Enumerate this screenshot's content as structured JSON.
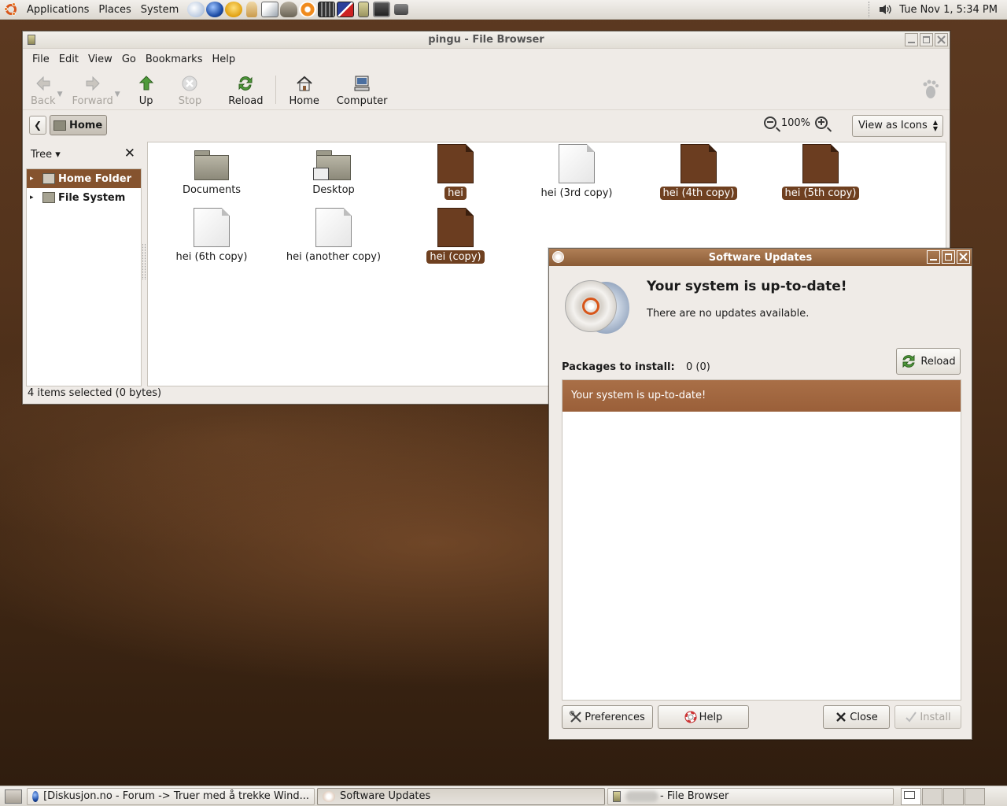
{
  "top_panel": {
    "menus": [
      "Applications",
      "Places",
      "System"
    ],
    "launcher_icons": [
      "web-browser-icon",
      "globe-icon",
      "messenger-icon",
      "pidgin-icon",
      "image-viewer-icon",
      "gimp-icon",
      "blender-icon",
      "calculator-icon",
      "text-editor-icon",
      "file-cabinet-icon",
      "terminal-icon",
      "camera-icon"
    ],
    "clock": "Tue Nov  1,  5:34 PM"
  },
  "file_browser": {
    "title": "pingu - File Browser",
    "menu": [
      "File",
      "Edit",
      "View",
      "Go",
      "Bookmarks",
      "Help"
    ],
    "toolbar": {
      "back": "Back",
      "forward": "Forward",
      "up": "Up",
      "stop": "Stop",
      "reload": "Reload",
      "home": "Home",
      "computer": "Computer"
    },
    "location": {
      "current": "Home"
    },
    "zoom": "100%",
    "view_mode": "View as Icons",
    "sidebar": {
      "mode": "Tree",
      "items": [
        {
          "label": "Home Folder",
          "selected": true
        },
        {
          "label": "File System",
          "selected": false
        }
      ]
    },
    "files": [
      {
        "name": "Documents",
        "kind": "folder",
        "selected": false
      },
      {
        "name": "Desktop",
        "kind": "folder",
        "selected": false
      },
      {
        "name": "hei",
        "kind": "file",
        "selected": true
      },
      {
        "name": "hei (3rd copy)",
        "kind": "file",
        "selected": false
      },
      {
        "name": "hei (4th copy)",
        "kind": "file",
        "selected": true
      },
      {
        "name": "hei (5th copy)",
        "kind": "file",
        "selected": true
      },
      {
        "name": "hei (6th copy)",
        "kind": "file",
        "selected": false
      },
      {
        "name": "hei (another copy)",
        "kind": "file",
        "selected": false
      },
      {
        "name": "hei (copy)",
        "kind": "file",
        "selected": true
      }
    ],
    "status": "4 items selected (0 bytes)"
  },
  "software_updates": {
    "title": "Software Updates",
    "heading": "Your system is up-to-date!",
    "subheading": "There are no updates available.",
    "reload": "Reload",
    "packages_label": "Packages to install:",
    "packages_count": "0 (0)",
    "list_row": "Your system is up-to-date!",
    "buttons": {
      "preferences": "Preferences",
      "help": "Help",
      "close": "Close",
      "install": "Install"
    }
  },
  "bottom_panel": {
    "tasks": [
      {
        "label": "[Diskusjon.no - Forum -> Truer med å trekke Wind..."
      },
      {
        "label": "Software Updates"
      },
      {
        "label": "- File Browser"
      }
    ]
  },
  "colors": {
    "accent": "#85532e",
    "selection": "#6f4020",
    "titlebar_active": "#8a5b36"
  }
}
